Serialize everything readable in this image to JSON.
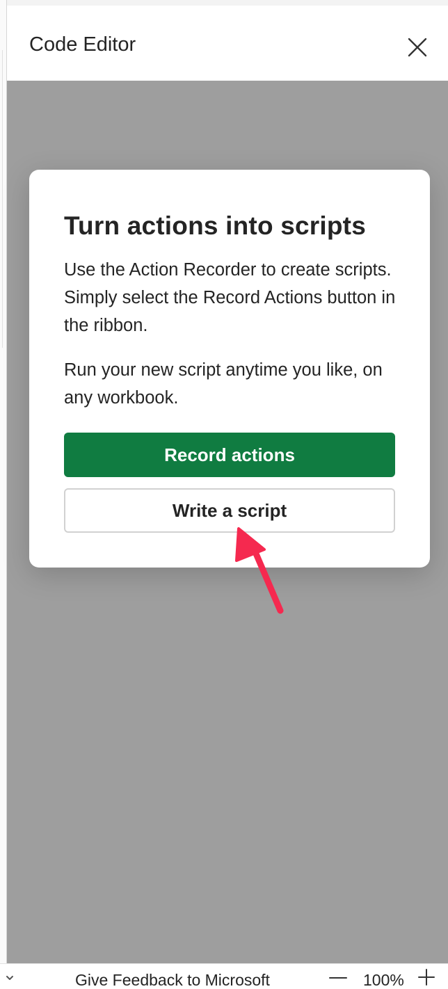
{
  "pane": {
    "title": "Code Editor"
  },
  "card": {
    "title": "Turn actions into scripts",
    "paragraph1": "Use the Action Recorder to create scripts. Simply select the Record Actions button in the ribbon.",
    "paragraph2": "Run your new script anytime you like, on any workbook.",
    "primary_button": "Record actions",
    "secondary_button": "Write a script"
  },
  "status_bar": {
    "feedback": "Give Feedback to Microsoft",
    "zoom": "100%"
  },
  "icons": {
    "close": "close-icon",
    "chevron": "chevron-down-icon",
    "zoom_out": "minus-icon",
    "zoom_in": "plus-icon",
    "annotation": "arrow-annotation"
  },
  "colors": {
    "accent": "#107c41",
    "overlay": "#9e9e9e",
    "annotation_arrow": "#f5294f"
  }
}
